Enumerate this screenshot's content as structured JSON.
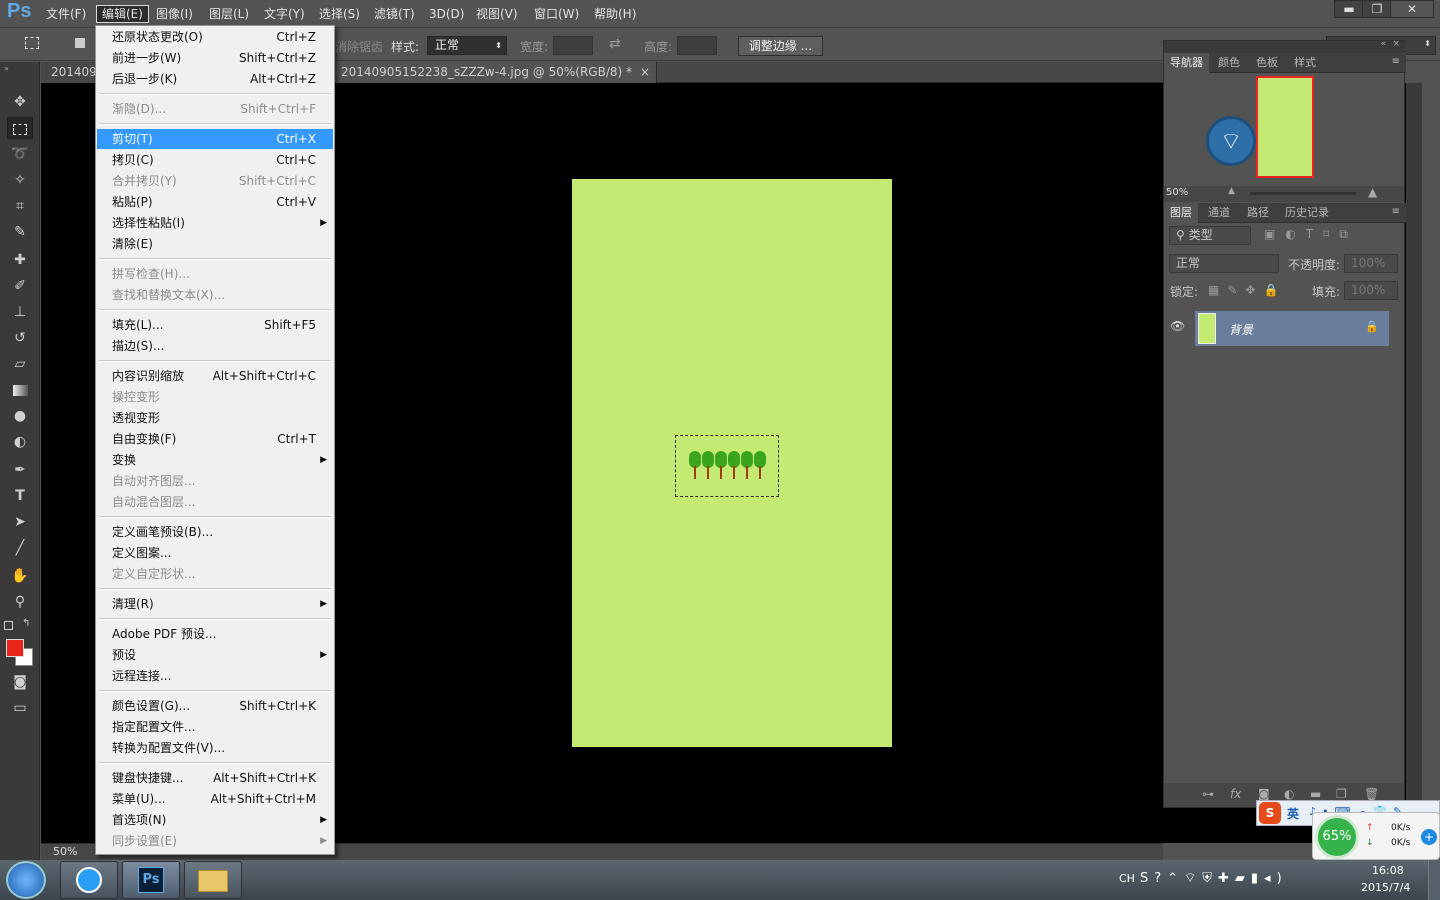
{
  "menubar": {
    "logo": "Ps",
    "items": [
      "文件(F)",
      "编辑(E)",
      "图像(I)",
      "图层(L)",
      "文字(Y)",
      "选择(S)",
      "滤镜(T)",
      "3D(D)",
      "视图(V)",
      "窗口(W)",
      "帮助(H)"
    ],
    "active": "编辑(E)"
  },
  "window_controls": {
    "minimize": "▬",
    "restore": "❐",
    "close": "✕"
  },
  "options": {
    "antialias": "消除锯齿",
    "style_label": "样式:",
    "style_value": "正常",
    "width_label": "宽度:",
    "height_label": "高度:",
    "refine_edge": "调整边缘 ..."
  },
  "tabs": {
    "left_tab": "20140905",
    "doc_tab": "20140905152238_sZZZw-4.jpg @ 50%(RGB/8) *",
    "close": "×"
  },
  "status": {
    "zoom": "50%"
  },
  "edit_menu": {
    "groups": [
      [
        {
          "label": "还原状态更改(O)",
          "shortcut": "Ctrl+Z"
        },
        {
          "label": "前进一步(W)",
          "shortcut": "Shift+Ctrl+Z"
        },
        {
          "label": "后退一步(K)",
          "shortcut": "Alt+Ctrl+Z"
        }
      ],
      [
        {
          "label": "渐隐(D)...",
          "shortcut": "Shift+Ctrl+F",
          "disabled": true
        }
      ],
      [
        {
          "label": "剪切(T)",
          "shortcut": "Ctrl+X",
          "highlighted": true
        },
        {
          "label": "拷贝(C)",
          "shortcut": "Ctrl+C"
        },
        {
          "label": "合并拷贝(Y)",
          "shortcut": "Shift+Ctrl+C",
          "disabled": true
        },
        {
          "label": "粘贴(P)",
          "shortcut": "Ctrl+V"
        },
        {
          "label": "选择性粘贴(I)",
          "submenu": true
        },
        {
          "label": "清除(E)"
        }
      ],
      [
        {
          "label": "拼写检查(H)...",
          "disabled": true
        },
        {
          "label": "查找和替换文本(X)...",
          "disabled": true
        }
      ],
      [
        {
          "label": "填充(L)...",
          "shortcut": "Shift+F5"
        },
        {
          "label": "描边(S)..."
        }
      ],
      [
        {
          "label": "内容识别缩放",
          "shortcut": "Alt+Shift+Ctrl+C"
        },
        {
          "label": "操控变形",
          "disabled": true
        },
        {
          "label": "透视变形"
        },
        {
          "label": "自由变换(F)",
          "shortcut": "Ctrl+T"
        },
        {
          "label": "变换",
          "submenu": true
        },
        {
          "label": "自动对齐图层...",
          "disabled": true
        },
        {
          "label": "自动混合图层...",
          "disabled": true
        }
      ],
      [
        {
          "label": "定义画笔预设(B)..."
        },
        {
          "label": "定义图案..."
        },
        {
          "label": "定义自定形状...",
          "disabled": true
        }
      ],
      [
        {
          "label": "清理(R)",
          "submenu": true
        }
      ],
      [
        {
          "label": "Adobe PDF 预设..."
        },
        {
          "label": "预设",
          "submenu": true
        },
        {
          "label": "远程连接..."
        }
      ],
      [
        {
          "label": "颜色设置(G)...",
          "shortcut": "Shift+Ctrl+K"
        },
        {
          "label": "指定配置文件..."
        },
        {
          "label": "转换为配置文件(V)..."
        }
      ],
      [
        {
          "label": "键盘快捷键...",
          "shortcut": "Alt+Shift+Ctrl+K"
        },
        {
          "label": "菜单(U)...",
          "shortcut": "Alt+Shift+Ctrl+M"
        },
        {
          "label": "首选项(N)",
          "submenu": true
        },
        {
          "label": "同步设置(E)",
          "submenu": true,
          "disabled": true
        }
      ]
    ]
  },
  "navigator": {
    "tabs": [
      "导航器",
      "颜色",
      "色板",
      "样式"
    ],
    "zoom": "50%"
  },
  "layers": {
    "tabs": [
      "图层",
      "通道",
      "路径",
      "历史记录"
    ],
    "filter": "类型",
    "blend_mode": "正常",
    "opacity_label": "不透明度:",
    "opacity": "100%",
    "lock_label": "锁定:",
    "fill_label": "填充:",
    "fill": "100%",
    "layer_name": "背景"
  },
  "tray": {
    "ime": "英",
    "lang": "CH",
    "net_percent": "65%",
    "up": "0K/s",
    "down": "0K/s",
    "time": "16:08",
    "date": "2015/7/4"
  },
  "colors": {
    "canvas": "#c4ea73",
    "foreground": "#e8251a",
    "menu_highlight": "#3399ff"
  }
}
